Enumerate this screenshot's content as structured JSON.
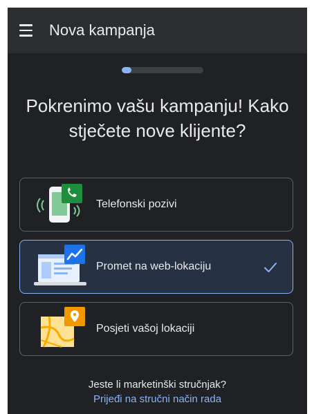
{
  "app_bar": {
    "title": "Nova kampanja",
    "menu_icon": "hamburger-menu-icon"
  },
  "progress": {
    "value_fraction": 0.12
  },
  "heading": {
    "line1": "Pokrenimo vašu kampanju! Kako",
    "line2": "stječete nove klijente?"
  },
  "options": [
    {
      "label": "Telefonski pozivi",
      "icon": "phone-calls-illustration",
      "selected": false
    },
    {
      "label": "Promet na web-lokaciju",
      "icon": "website-traffic-illustration",
      "selected": true
    },
    {
      "label": "Posjeti vašoj lokaciji",
      "icon": "store-visits-map-illustration",
      "selected": false
    }
  ],
  "footer": {
    "question": "Jeste li marketinški stručnjak?",
    "link": "Prijeđi na stručni način rada"
  },
  "colors": {
    "background": "#202124",
    "app_bar": "#2c2d30",
    "accent": "#8ab4f8",
    "icon_green": "#1e8e3e",
    "icon_blue": "#1a73e8",
    "icon_orange": "#f29900"
  }
}
